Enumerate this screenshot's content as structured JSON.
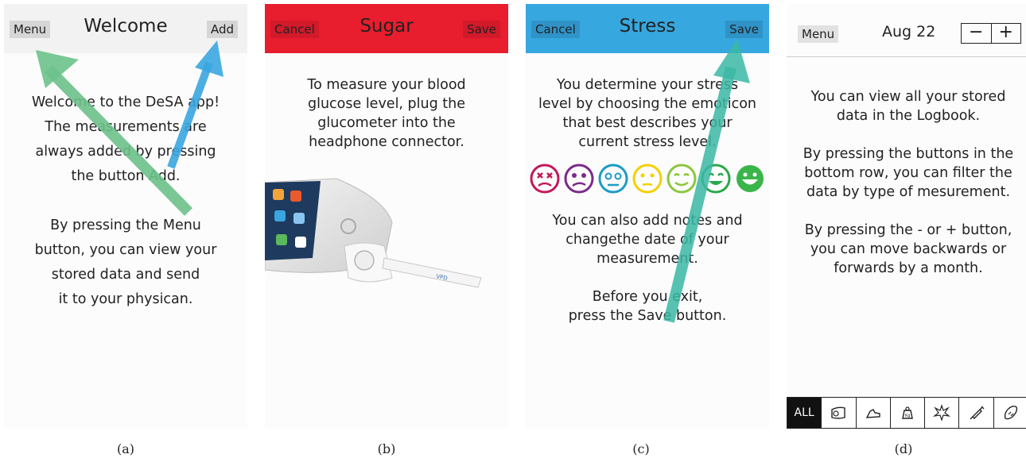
{
  "panels": [
    {
      "header": {
        "title": "Welcome",
        "left_button": "Menu",
        "right_button": "Add",
        "color": "#f2f2f2"
      },
      "text": "Welcome to the DeSA app!\nThe measurements are\nalways added by pressing\nthe button Add.\n\nBy pressing the Menu\nbutton, you can view your\nstored data and send\nit to your physican.",
      "caption": "(a)"
    },
    {
      "header": {
        "title": "Sugar",
        "left_button": "Cancel",
        "right_button": "Save",
        "color": "#e81d2d"
      },
      "text": "To measure your blood\nglucose level, plug the\nglucometer into the\nheadphone connector.",
      "device_label": "VPD",
      "caption": "(b)"
    },
    {
      "header": {
        "title": "Stress",
        "left_button": "Cancel",
        "right_button": "Save",
        "color": "#36a7df"
      },
      "text": "You determine your stress\nlevel by choosing the emoticon\nthat best describes your\ncurrent stress level.",
      "emoticons": [
        "dead-face-icon",
        "frown-face-icon",
        "worried-face-icon",
        "neutral-face-icon",
        "slight-smile-icon",
        "smile-face-icon",
        "grin-face-icon"
      ],
      "emoticon_colors": [
        "#c2185b",
        "#7b2a8a",
        "#1d9bc4",
        "#f2d100",
        "#8dc63f",
        "#2aa84a",
        "#3ab54a"
      ],
      "text2": "You can also add notes and\nchangethe date of your\nmeasurement.\n\nBefore you exit,\npress the Save button.",
      "caption": "(c)"
    },
    {
      "header": {
        "left_button": "Menu",
        "date": "Aug 22",
        "minus": "−",
        "plus": "+"
      },
      "text": "You can view all your stored\ndata in the Logbook.\n\nBy pressing the buttons in the\nbottom row, you can filter the\ndata by type of mesurement.\n\nBy pressing the - or + button,\nyou can move backwards or\nforwards by a month.",
      "filters": [
        "ALL",
        "glucometer-icon",
        "shoe-icon",
        "weight-icon",
        "stress-burst-icon",
        "syringe-icon",
        "bread-icon"
      ],
      "weight_label": "Kg",
      "caption": "(d)"
    }
  ],
  "arrow_colors": {
    "green": "#6cc28a",
    "blue": "#3aa6e0",
    "teal": "#3bb8a4"
  }
}
